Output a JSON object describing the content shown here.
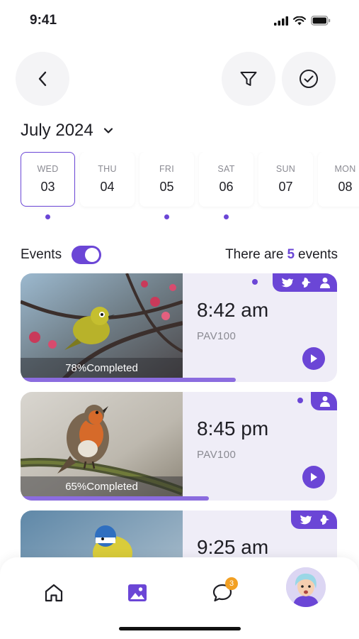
{
  "status_bar": {
    "time": "9:41"
  },
  "header": {
    "back_icon": "chevron-left-icon",
    "filter_icon": "filter-icon",
    "check_icon": "check-circle-icon"
  },
  "calendar": {
    "month": "July 2024",
    "days": [
      {
        "name": "WED",
        "num": "03",
        "selected": true,
        "has_event": true
      },
      {
        "name": "THU",
        "num": "04",
        "selected": false,
        "has_event": false
      },
      {
        "name": "FRI",
        "num": "05",
        "selected": false,
        "has_event": true
      },
      {
        "name": "SAT",
        "num": "06",
        "selected": false,
        "has_event": true
      },
      {
        "name": "SUN",
        "num": "07",
        "selected": false,
        "has_event": false
      },
      {
        "name": "MON",
        "num": "08",
        "selected": false,
        "has_event": false
      }
    ]
  },
  "events": {
    "label": "Events",
    "toggle_on": true,
    "count_prefix": "There are",
    "count": "5",
    "count_suffix": "events"
  },
  "cards": [
    {
      "time": "8:42 am",
      "code": "PAV100",
      "completed": "78%Completed",
      "progress": 0.78,
      "tags": [
        "bird-icon",
        "wildlife-icon",
        "person-icon"
      ],
      "dot": true
    },
    {
      "time": "8:45 pm",
      "code": "PAV100",
      "completed": "65%Completed",
      "progress": 0.65,
      "tags": [
        "person-icon"
      ],
      "dot": true
    },
    {
      "time": "9:25 am",
      "code": "",
      "completed": "",
      "progress": null,
      "tags": [
        "bird-icon",
        "wildlife-icon"
      ],
      "dot": false
    }
  ],
  "bottom_nav": {
    "items": [
      "home-icon",
      "gallery-icon",
      "chat-icon",
      "avatar"
    ],
    "chat_badge": "3"
  },
  "colors": {
    "accent": "#6b46d6",
    "card_bg": "#efedf7",
    "badge": "#f2a023"
  }
}
